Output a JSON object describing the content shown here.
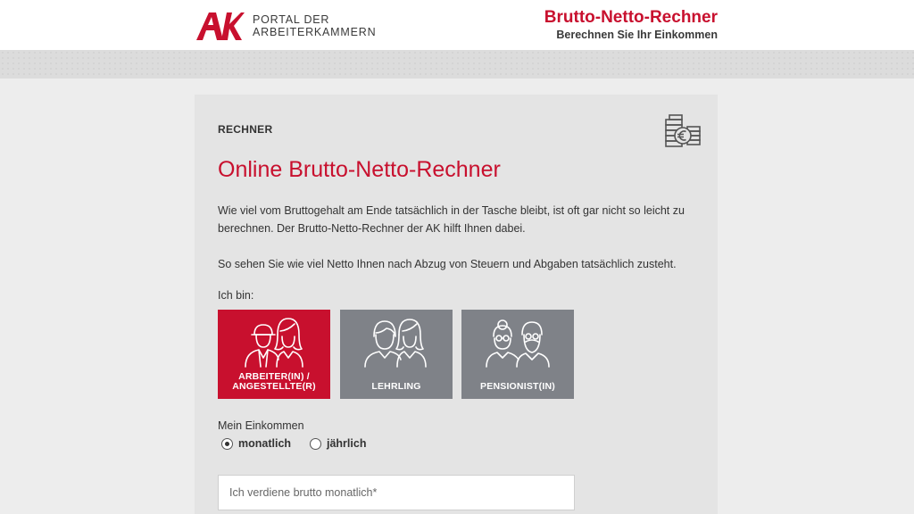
{
  "header": {
    "logo_text": "AK",
    "portal_line1": "PORTAL DER",
    "portal_line2": "ARBEITERKAMMERN",
    "title": "Brutto-Netto-Rechner",
    "subtitle": "Berechnen Sie Ihr Einkommen"
  },
  "main": {
    "section_label": "RECHNER",
    "title": "Online Brutto-Netto-Rechner",
    "intro": "Wie viel vom Bruttogehalt am Ende tatsächlich in der Tasche bleibt, ist oft gar nicht so leicht zu berechnen. Der Brutto-Netto-Rechner der AK hilft Ihnen dabei.",
    "intro2": "So sehen Sie wie viel Netto Ihnen nach Abzug von Steuern und Abgaben tatsächlich zusteht.",
    "ich_bin": "Ich bin:",
    "options": [
      {
        "line1": "ARBEITER(IN) /",
        "line2": "ANGESTELLTE(R)",
        "selected": true
      },
      {
        "line1": "LEHRLING",
        "line2": "",
        "selected": false
      },
      {
        "line1": "PENSIONIST(IN)",
        "line2": "",
        "selected": false
      }
    ],
    "income_label": "Mein Einkommen",
    "radios": [
      {
        "label": "monatlich",
        "checked": true
      },
      {
        "label": "jährlich",
        "checked": false
      }
    ],
    "input_placeholder": "Ich verdiene brutto monatlich*"
  },
  "colors": {
    "accent": "#c8102e",
    "option_bg": "#7f8288"
  },
  "icons": {
    "calculator": "coins-euro-icon"
  }
}
